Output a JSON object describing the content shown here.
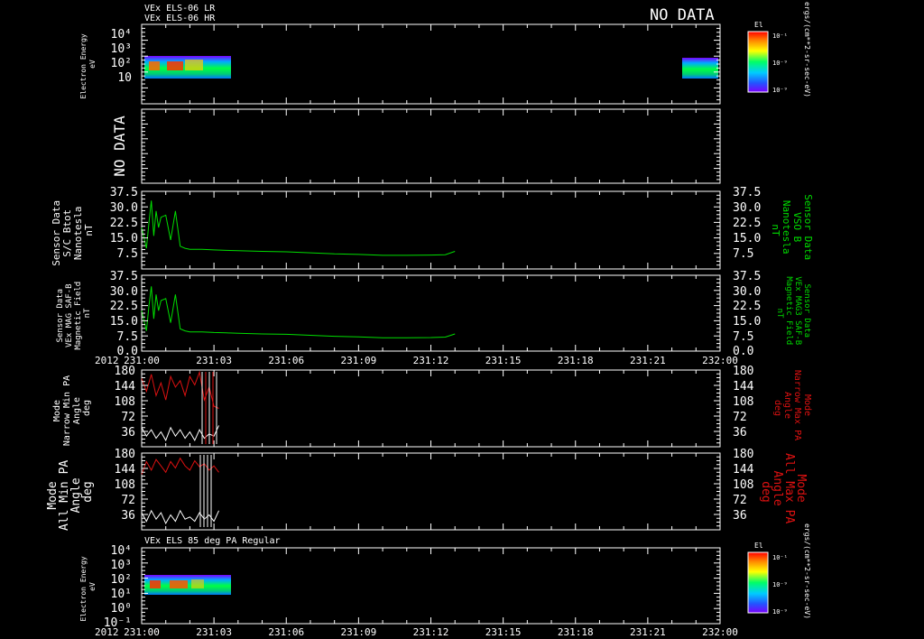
{
  "colors": {
    "background": "#000000",
    "frame": "#ffffff",
    "green": "#00dd00",
    "red": "#dd1111",
    "white": "#ffffff"
  },
  "x_axis": {
    "year_label": "2012",
    "tick_labels": [
      "231:00",
      "231:03",
      "231:06",
      "231:09",
      "231:12",
      "231:15",
      "231:18",
      "231:21",
      "232:00"
    ]
  },
  "chart_data": [
    {
      "type": "heatmap",
      "id": "p1",
      "titles": [
        "VEx ELS-06 LR",
        "VEx ELS-06 HR"
      ],
      "status": "NO DATA",
      "ylabel": [
        "Electron Energy",
        "eV"
      ],
      "y_tick_labels": [
        "10⁴",
        "10³",
        "10²",
        "10"
      ],
      "y_scale": "log",
      "ylim": [
        1,
        30000
      ],
      "data_intervals": [
        [
          "231:00",
          "231:03.3"
        ],
        [
          "231:22.5",
          "232:00"
        ]
      ],
      "colorbar": {
        "title": "El",
        "unit": "ergs/(cm**2-sr-sec-eV)",
        "tick_labels": [
          "10⁻¹",
          "10⁻⁹",
          "10⁻⁹"
        ]
      }
    },
    {
      "type": "line",
      "id": "p2",
      "status": "NO DATA"
    },
    {
      "type": "line",
      "id": "p3",
      "ylabel_left": [
        "Sensor Data",
        "S/C Btot",
        "Nanotesla",
        "nT"
      ],
      "ylabel_right": [
        "Sensor Data",
        "VSO B",
        "Nanotesla",
        "nT"
      ],
      "y_tick_labels": [
        "37.5",
        "30.0",
        "22.5",
        "15.0",
        "7.5"
      ],
      "ylim": [
        0,
        37.5
      ],
      "series": [
        {
          "color": "green",
          "x": [
            0,
            0.2,
            0.3,
            0.4,
            0.5,
            0.6,
            0.7,
            0.8,
            1.0,
            1.2,
            1.4,
            1.6,
            1.8,
            2.0,
            2.5,
            3.0,
            3.5,
            4.0,
            5.0,
            6.0,
            7.0,
            8.0,
            9.0,
            10.0,
            11.0,
            12.0,
            12.6,
            13.0
          ],
          "y": [
            20,
            10,
            22,
            33,
            16,
            28,
            20,
            25,
            26,
            14,
            28,
            11,
            10,
            9.5,
            9.5,
            9.2,
            9,
            8.8,
            8.5,
            8.3,
            7.8,
            7.3,
            7.0,
            6.6,
            6.6,
            6.7,
            6.9,
            8.5
          ]
        }
      ]
    },
    {
      "type": "line",
      "id": "p4",
      "ylabel_left": [
        "Sensor Data",
        "VEx MAG SAF-B",
        "Magnetic Field",
        "nT"
      ],
      "ylabel_right": [
        "Sensor Data",
        "VEx MAG3 SAF-B",
        "Magnetic Field",
        "nT"
      ],
      "y_tick_labels": [
        "37.5",
        "30.0",
        "22.5",
        "15.0",
        "7.5",
        "0.0"
      ],
      "ylim": [
        0,
        37.5
      ],
      "series": [
        {
          "color": "green",
          "x": [
            0,
            0.2,
            0.3,
            0.4,
            0.5,
            0.6,
            0.7,
            0.8,
            1.0,
            1.2,
            1.4,
            1.6,
            1.8,
            2.0,
            2.5,
            3.0,
            3.5,
            4.0,
            5.0,
            6.0,
            7.0,
            8.0,
            9.0,
            10.0,
            11.0,
            12.0,
            12.6,
            13.0
          ],
          "y": [
            20,
            10,
            22,
            32,
            16,
            28,
            20,
            25,
            26,
            14,
            28,
            11,
            10,
            9.5,
            9.5,
            9.2,
            9,
            8.8,
            8.5,
            8.3,
            7.8,
            7.3,
            7.0,
            6.6,
            6.6,
            6.7,
            6.9,
            8.5
          ]
        }
      ]
    },
    {
      "type": "line",
      "id": "p5",
      "ylabel_left": [
        "Mode",
        "Narrow Min PA",
        "Angle",
        "deg"
      ],
      "ylabel_right": [
        "Mode",
        "Narrow Max PA",
        "Angle",
        "deg"
      ],
      "y_tick_labels": [
        "180",
        "144",
        "108",
        "72",
        "36"
      ],
      "ylim": [
        0,
        180
      ],
      "series": [
        {
          "color": "red",
          "x": [
            0,
            0.2,
            0.4,
            0.6,
            0.8,
            1.0,
            1.2,
            1.4,
            1.6,
            1.8,
            2.0,
            2.2,
            2.4,
            2.6,
            2.8,
            3.0,
            3.2
          ],
          "y": [
            160,
            130,
            170,
            120,
            150,
            110,
            165,
            140,
            155,
            120,
            165,
            145,
            175,
            110,
            140,
            95,
            90
          ]
        },
        {
          "color": "white",
          "x": [
            0,
            0.2,
            0.4,
            0.6,
            0.8,
            1.0,
            1.2,
            1.4,
            1.6,
            1.8,
            2.0,
            2.2,
            2.4,
            2.6,
            2.8,
            3.0,
            3.2
          ],
          "y": [
            45,
            25,
            40,
            20,
            35,
            15,
            45,
            25,
            40,
            20,
            35,
            15,
            40,
            20,
            30,
            25,
            50
          ]
        }
      ]
    },
    {
      "type": "line",
      "id": "p6",
      "ylabel_left": [
        "Mode",
        "All Min PA",
        "Angle",
        "deg"
      ],
      "ylabel_right": [
        "Mode",
        "All Max PA",
        "Angle",
        "deg"
      ],
      "y_tick_labels": [
        "180",
        "144",
        "108",
        "72",
        "36"
      ],
      "ylim": [
        0,
        180
      ],
      "series": [
        {
          "color": "red",
          "x": [
            0,
            0.2,
            0.4,
            0.6,
            0.8,
            1.0,
            1.2,
            1.4,
            1.6,
            1.8,
            2.0,
            2.2,
            2.4,
            2.6,
            2.8,
            3.0,
            3.2
          ],
          "y": [
            130,
            160,
            140,
            165,
            150,
            135,
            160,
            145,
            168,
            150,
            140,
            162,
            148,
            155,
            140,
            150,
            135
          ]
        },
        {
          "color": "white",
          "x": [
            0,
            0.2,
            0.4,
            0.6,
            0.8,
            1.0,
            1.2,
            1.4,
            1.6,
            1.8,
            2.0,
            2.2,
            2.4,
            2.6,
            2.8,
            3.0,
            3.2
          ],
          "y": [
            40,
            20,
            45,
            25,
            40,
            15,
            35,
            20,
            45,
            25,
            30,
            20,
            40,
            25,
            35,
            20,
            45
          ]
        }
      ]
    },
    {
      "type": "heatmap",
      "id": "p7",
      "titles": [
        "VEx ELS 85 deg PA Regular"
      ],
      "ylabel": [
        "Electron Energy",
        "eV"
      ],
      "y_tick_labels": [
        "10⁴",
        "10³",
        "10²",
        "10¹",
        "10⁰",
        "10⁻¹"
      ],
      "y_scale": "log",
      "ylim": [
        0.1,
        30000
      ],
      "data_intervals": [
        [
          "231:00",
          "231:03.3"
        ]
      ],
      "colorbar": {
        "title": "El",
        "unit": "ergs/(cm**2-sr-sec-eV)",
        "tick_labels": [
          "10⁻¹",
          "10⁻⁹",
          "10⁻⁹"
        ]
      }
    }
  ]
}
